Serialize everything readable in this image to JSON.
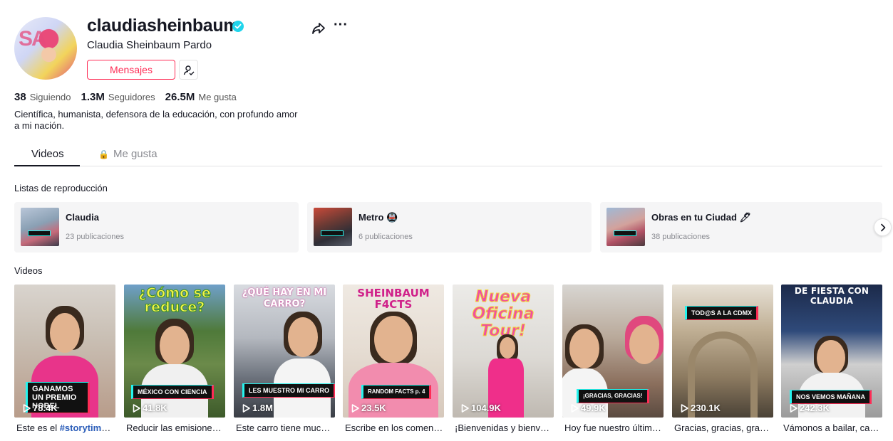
{
  "profile": {
    "username": "claudiasheinbaum",
    "nickname": "Claudia Sheinbaum Pardo",
    "avatar_letters": "SA",
    "message_label": "Mensajes",
    "verified_icon": "verified-icon",
    "accent_color": "#fe2c55",
    "verified_color": "#20d5ec"
  },
  "stats": [
    {
      "value": "38",
      "label": "Siguiendo"
    },
    {
      "value": "1.3M",
      "label": "Seguidores"
    },
    {
      "value": "26.5M",
      "label": "Me gusta"
    }
  ],
  "bio": "Científica, humanista, defensora de la educación, con profundo amor a mi nación.",
  "tabs": [
    {
      "label": "Videos",
      "active": true
    },
    {
      "label": "Me gusta",
      "locked": true
    }
  ],
  "playlists_title": "Listas de reproducción",
  "playlists": [
    {
      "title": "Claudia",
      "count": "23 publicaciones"
    },
    {
      "title": "Metro 🚇",
      "count": "6 publicaciones"
    },
    {
      "title": "Obras en tu Ciudad 🖊",
      "count": "38 publicaciones"
    }
  ],
  "videos_title": "Videos",
  "videos": [
    {
      "badge": "GANAMOS UN PREMIO NOBEL",
      "views": "78.4K",
      "desc_prefix": "Este es el ",
      "desc_tag": "#storytime ...",
      "headline": ""
    },
    {
      "badge": "MÉXICO CON CIENCIA",
      "views": "41.8K",
      "desc_prefix": "Reducir las emisiones ...",
      "desc_tag": "",
      "headline": "¿Cómo se reduce?"
    },
    {
      "badge": "LES MUESTRO MI CARRO",
      "views": "1.8M",
      "desc_prefix": "Este carro tiene mucha...",
      "desc_tag": "",
      "headline": "¿QUÉ HAY EN MI CARRO?"
    },
    {
      "badge": "RANDOM FACTS p. 4",
      "views": "23.5K",
      "desc_prefix": "Escribe en los coment...",
      "desc_tag": "",
      "headline": "SHEINBAUM F4CTS"
    },
    {
      "badge": "",
      "views": "104.9K",
      "desc_prefix": "¡Bienvenidas y bienve...",
      "desc_tag": "",
      "headline": "Nueva Oficina Tour!"
    },
    {
      "badge": "¡GRACIAS, GRACIAS!",
      "views": "49.9K",
      "desc_prefix": "Hoy fue nuestro último...",
      "desc_tag": "",
      "headline": ""
    },
    {
      "badge": "TOD@S A LA CDMX",
      "views": "230.1K",
      "desc_prefix": "Gracias, gracias, graci...",
      "desc_tag": "",
      "headline": ""
    },
    {
      "badge": "NOS VEMOS MAÑANA",
      "views": "242.3K",
      "desc_prefix": "Vámonos a bailar, cant...",
      "desc_tag": "",
      "headline": "DE FIESTA CON CLAUDIA"
    }
  ]
}
